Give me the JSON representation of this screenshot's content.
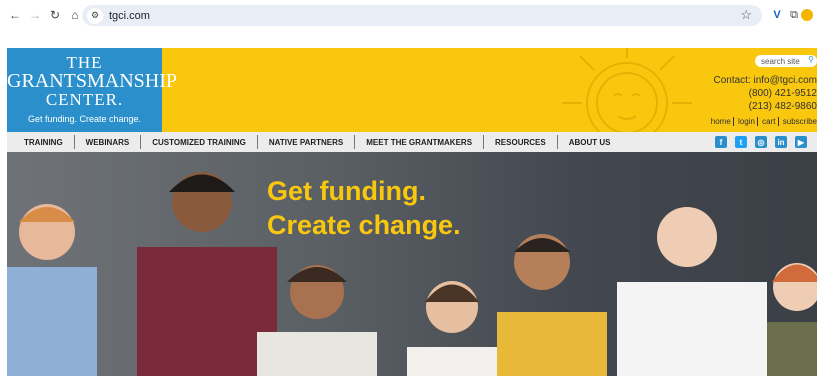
{
  "browser": {
    "url": "tgci.com"
  },
  "logo": {
    "line1": "THE",
    "line2": "GRANTSMANSHIP",
    "line3": "CENTER.",
    "tagline": "Get funding. Create change."
  },
  "header": {
    "search_placeholder": "search site",
    "contact": "Contact: info@tgci.com",
    "phone1": "(800) 421-9512",
    "phone2": "(213) 482-9860",
    "links": [
      "home",
      "login",
      "cart",
      "subscribe"
    ]
  },
  "menu": {
    "items": [
      "TRAINING",
      "WEBINARS",
      "CUSTOMIZED TRAINING",
      "NATIVE PARTNERS",
      "MEET THE GRANTMAKERS",
      "RESOURCES",
      "ABOUT US"
    ]
  },
  "social": [
    "f",
    "t",
    "ig",
    "in",
    "yt"
  ],
  "hero": {
    "line1": "Get funding.",
    "line2": "Create change."
  },
  "colors": {
    "brand_yellow": "#f9c80e",
    "brand_blue": "#2a8fcb"
  }
}
